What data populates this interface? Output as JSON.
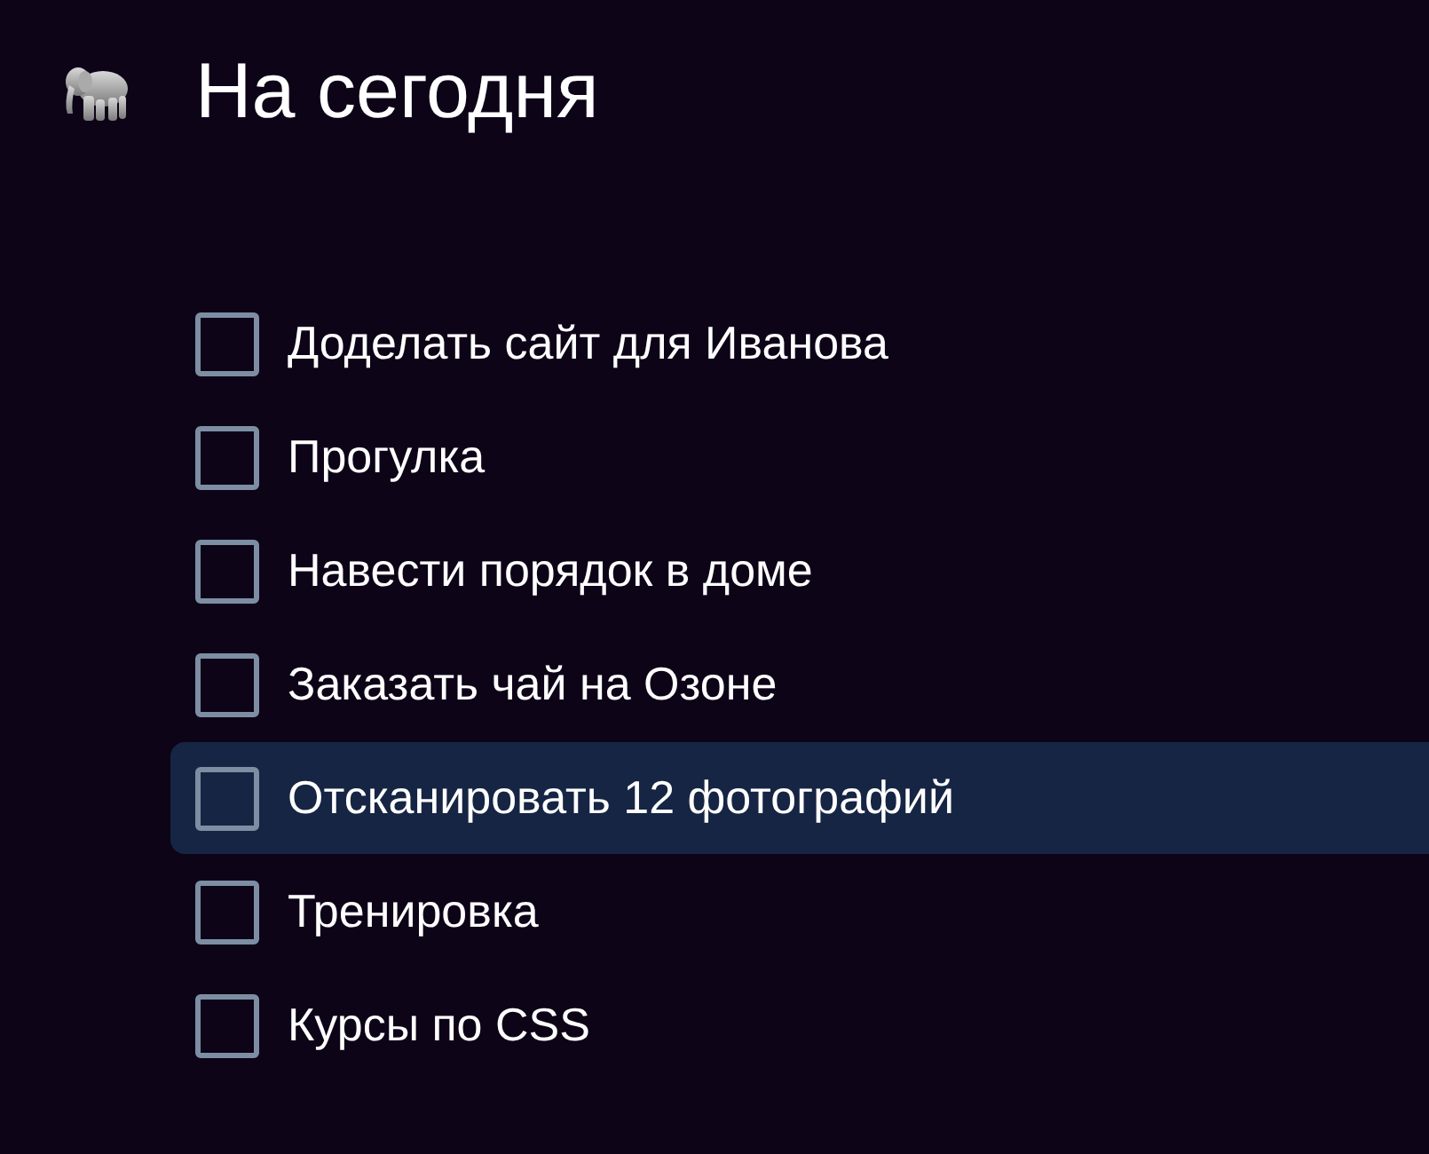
{
  "title": "На сегодня",
  "tasks": [
    {
      "label": "Доделать сайт для Иванова",
      "checked": false,
      "selected": false
    },
    {
      "label": "Прогулка",
      "checked": false,
      "selected": false
    },
    {
      "label": "Навести порядок в доме",
      "checked": false,
      "selected": false
    },
    {
      "label": "Заказать чай на Озоне",
      "checked": false,
      "selected": false
    },
    {
      "label": "Отсканировать 12 фотографий",
      "checked": false,
      "selected": true
    },
    {
      "label": "Тренировка",
      "checked": false,
      "selected": false
    },
    {
      "label": "Курсы по CSS",
      "checked": false,
      "selected": false
    }
  ]
}
